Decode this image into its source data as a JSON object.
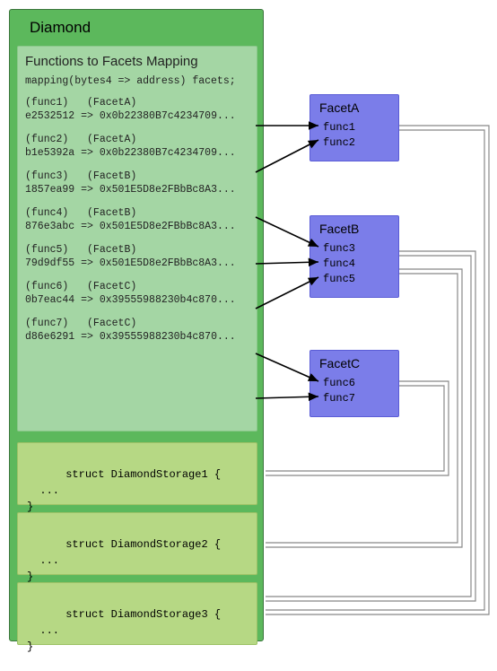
{
  "diamond": {
    "title": "Diamond",
    "mapping_panel_title": "Functions to Facets Mapping",
    "mapping_decl": "mapping(bytes4 => address) facets;",
    "rows": [
      {
        "funcLabel": "(func1)",
        "facetLabel": "(FacetA)",
        "selector": "e2532512",
        "arrow": "=>",
        "addr": "0x0b22380B7c4234709..."
      },
      {
        "funcLabel": "(func2)",
        "facetLabel": "(FacetA)",
        "selector": "b1e5392a",
        "arrow": "=>",
        "addr": "0x0b22380B7c4234709..."
      },
      {
        "funcLabel": "(func3)",
        "facetLabel": "(FacetB)",
        "selector": "1857ea99",
        "arrow": "=>",
        "addr": "0x501E5D8e2FBbBc8A3..."
      },
      {
        "funcLabel": "(func4)",
        "facetLabel": "(FacetB)",
        "selector": "876e3abc",
        "arrow": "=>",
        "addr": "0x501E5D8e2FBbBc8A3..."
      },
      {
        "funcLabel": "(func5)",
        "facetLabel": "(FacetB)",
        "selector": "79d9df55",
        "arrow": "=>",
        "addr": "0x501E5D8e2FBbBc8A3..."
      },
      {
        "funcLabel": "(func6)",
        "facetLabel": "(FacetC)",
        "selector": "0b7eac44",
        "arrow": "=>",
        "addr": "0x39555988230b4c870..."
      },
      {
        "funcLabel": "(func7)",
        "facetLabel": "(FacetC)",
        "selector": "d86e6291",
        "arrow": "=>",
        "addr": "0x39555988230b4c870..."
      }
    ],
    "storages": [
      {
        "decl": "struct DiamondStorage1 {",
        "dots": "  ...",
        "close": "}"
      },
      {
        "decl": "struct DiamondStorage2 {",
        "dots": "  ...",
        "close": "}"
      },
      {
        "decl": "struct DiamondStorage3 {",
        "dots": "  ...",
        "close": "}"
      }
    ]
  },
  "facets": [
    {
      "name": "FacetA",
      "funcs": [
        "func1",
        "func2"
      ]
    },
    {
      "name": "FacetB",
      "funcs": [
        "func3",
        "func4",
        "func5"
      ]
    },
    {
      "name": "FacetC",
      "funcs": [
        "func6",
        "func7"
      ]
    }
  ]
}
